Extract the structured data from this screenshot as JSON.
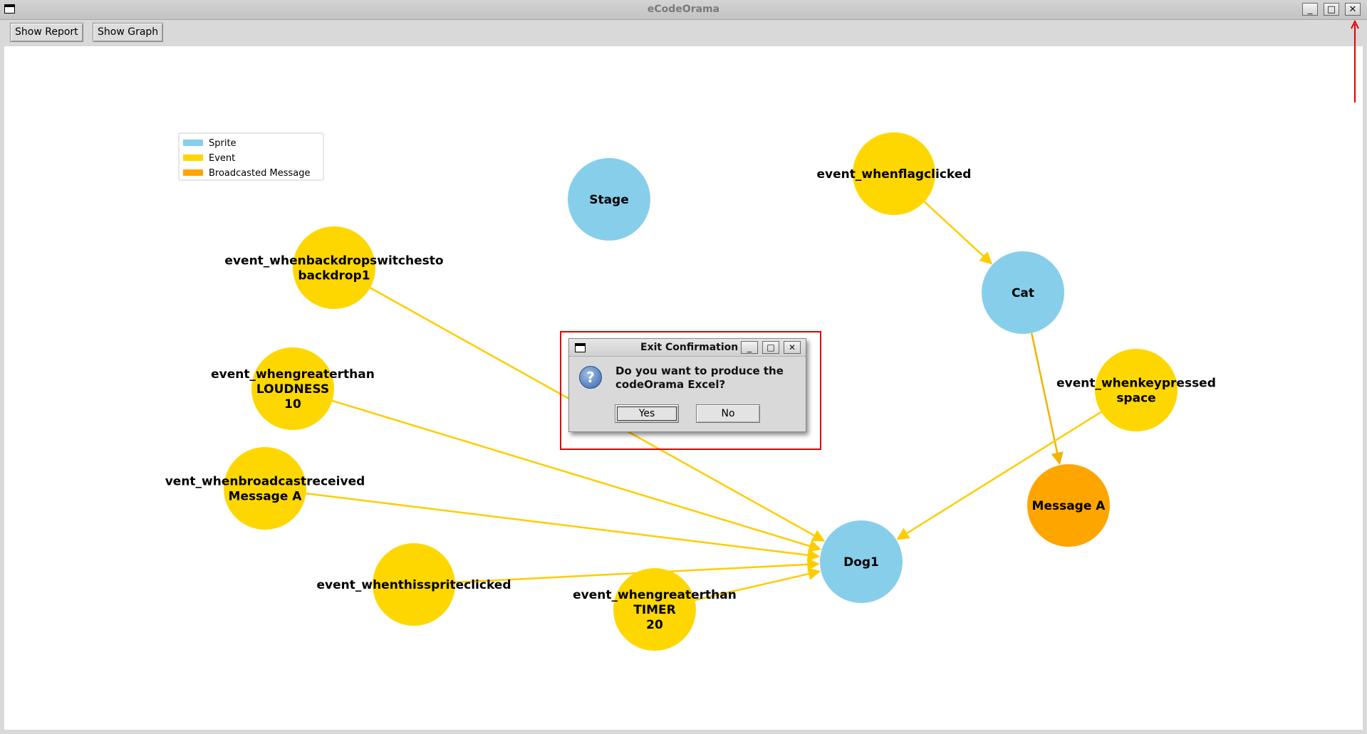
{
  "window": {
    "title": "eCodeOrama",
    "controls": {
      "minimize": "_",
      "maximize": "□",
      "close": "✕"
    }
  },
  "toolbar": {
    "show_report": "Show Report",
    "show_graph": "Show Graph"
  },
  "legend": [
    {
      "label": "Sprite",
      "color": "#87ceeb"
    },
    {
      "label": "Event",
      "color": "#ffd700"
    },
    {
      "label": "Broadcasted Message",
      "color": "#ffa500"
    }
  ],
  "graph": {
    "colors": {
      "sprite": "#87ceeb",
      "event": "#ffd700",
      "message": "#ffa500",
      "edge": "#ffcc00",
      "edge_dark": "#f0b400"
    },
    "nodes": [
      {
        "id": "stage",
        "kind": "sprite",
        "lines": [
          "Stage"
        ]
      },
      {
        "id": "flag",
        "kind": "event",
        "lines": [
          "event_whenflagclicked"
        ]
      },
      {
        "id": "cat",
        "kind": "sprite",
        "lines": [
          "Cat"
        ]
      },
      {
        "id": "backdrop",
        "kind": "event",
        "lines": [
          "event_whenbackdropswitchesto",
          "backdrop1"
        ]
      },
      {
        "id": "loudness",
        "kind": "event",
        "lines": [
          "event_whengreaterthan",
          "LOUDNESS",
          "10"
        ]
      },
      {
        "id": "keypressed",
        "kind": "event",
        "lines": [
          "event_whenkeypressed",
          "space"
        ]
      },
      {
        "id": "broadcastrecv",
        "kind": "event",
        "lines": [
          "vent_whenbroadcastreceived",
          "Message A"
        ]
      },
      {
        "id": "msgA",
        "kind": "message",
        "lines": [
          "Message A"
        ]
      },
      {
        "id": "dog1",
        "kind": "sprite",
        "lines": [
          "Dog1"
        ]
      },
      {
        "id": "spriteclicked",
        "kind": "event",
        "lines": [
          "event_whenthisspriteclicked"
        ]
      },
      {
        "id": "timer",
        "kind": "event",
        "lines": [
          "event_whengreaterthan",
          "TIMER",
          "20"
        ]
      }
    ],
    "edges": [
      {
        "from": "flag",
        "to": "cat"
      },
      {
        "from": "cat",
        "to": "msgA"
      },
      {
        "from": "keypressed",
        "to": "dog1"
      },
      {
        "from": "backdrop",
        "to": "dog1"
      },
      {
        "from": "loudness",
        "to": "dog1"
      },
      {
        "from": "broadcastrecv",
        "to": "dog1"
      },
      {
        "from": "spriteclicked",
        "to": "dog1"
      },
      {
        "from": "timer",
        "to": "dog1"
      }
    ]
  },
  "dialog": {
    "title": "Exit Confirmation",
    "question_glyph": "?",
    "message_line1": "Do you want to produce the",
    "message_line2": "codeOrama Excel?",
    "yes_label": "Yes",
    "no_label": "No"
  },
  "annotation_color": "#e00000"
}
